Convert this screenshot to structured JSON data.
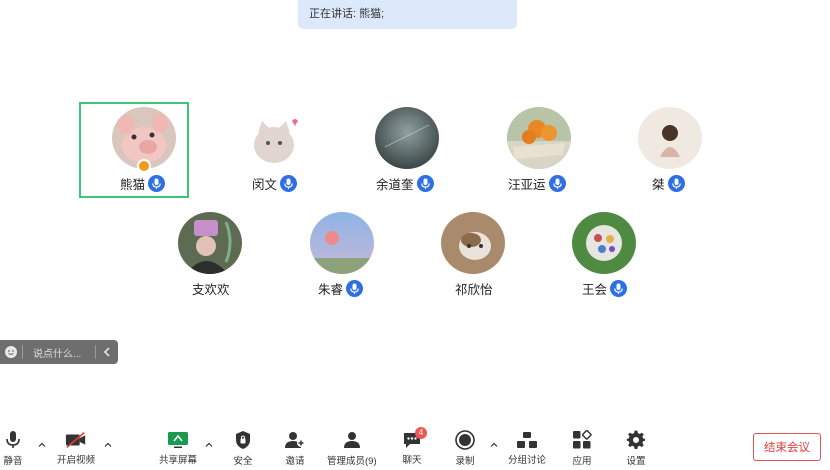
{
  "speaking_banner": "正在讲话: 熊猫;",
  "participants": [
    {
      "name": "熊猫",
      "mic": true,
      "host": true,
      "active": true
    },
    {
      "name": "闵文",
      "mic": true
    },
    {
      "name": "余道奎",
      "mic": true
    },
    {
      "name": "汪亚运",
      "mic": true
    },
    {
      "name": "桀",
      "mic": true
    },
    {
      "name": "支欢欢",
      "mic": false
    },
    {
      "name": "朱睿",
      "mic": true
    },
    {
      "name": "祁欣怡",
      "mic": false
    },
    {
      "name": "王会",
      "mic": true
    }
  ],
  "chat": {
    "placeholder": "说点什么..."
  },
  "toolbar": {
    "mute": "静音",
    "video": "开启视频",
    "share": "共享屏幕",
    "security": "安全",
    "invite": "邀请",
    "members": "管理成员(9)",
    "chat": "聊天",
    "chat_badge": "4",
    "record": "录制",
    "breakout": "分组讨论",
    "apps": "应用",
    "settings": "设置",
    "end": "结束会议"
  },
  "colors": {
    "active_border": "#3cc576",
    "mic_blue": "#2f6fe4",
    "end_red": "#e33d3d",
    "badge_red": "#f05656",
    "host_orange": "#f19a22"
  }
}
